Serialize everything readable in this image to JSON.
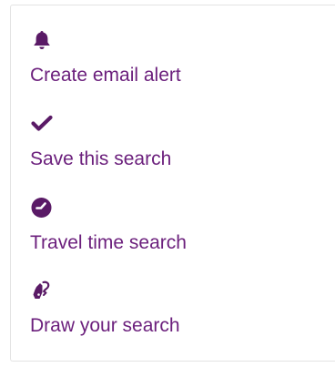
{
  "colors": {
    "link": "#6b1f7c",
    "icon": "#5a1a66",
    "panel_border": "#e3e3e3",
    "background": "#ffffff"
  },
  "actions": [
    {
      "icon": "bell-icon",
      "label": "Create email alert"
    },
    {
      "icon": "checkmark-icon",
      "label": "Save this search"
    },
    {
      "icon": "clock-icon",
      "label": "Travel time search"
    },
    {
      "icon": "draw-hand-icon",
      "label": "Draw your search"
    }
  ]
}
